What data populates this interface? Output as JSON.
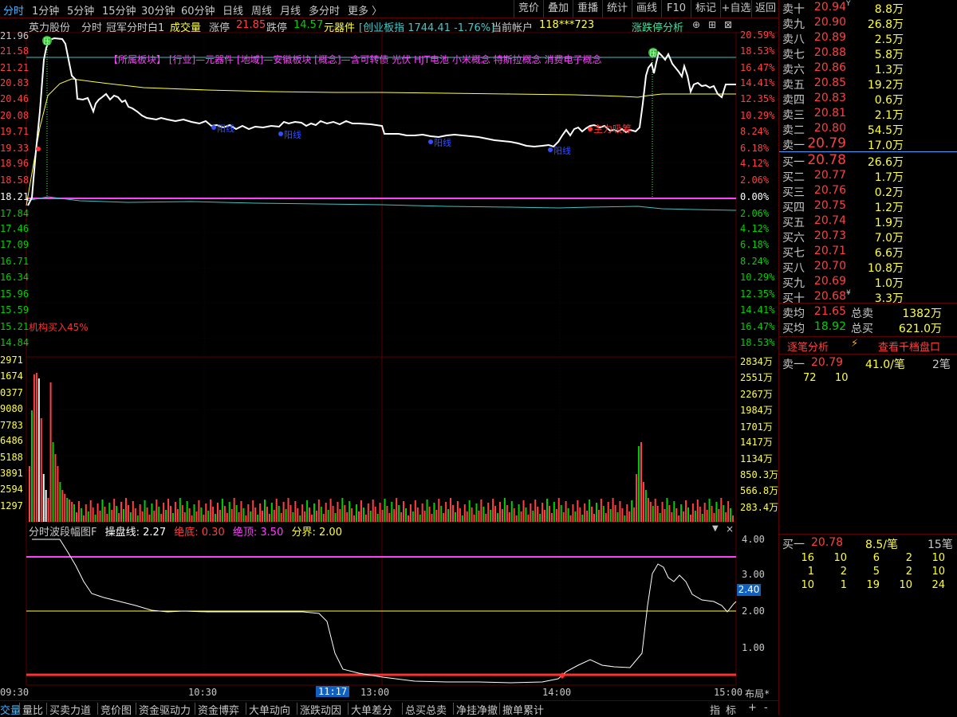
{
  "top_tabs": [
    "分时",
    "1分钟",
    "5分钟",
    "15分钟",
    "30分钟",
    "60分钟",
    "日线",
    "周线",
    "月线",
    "多分时",
    "更多 〉"
  ],
  "right_buttons": [
    "竞价",
    "叠加",
    "重播",
    "统计",
    "画线",
    "F10",
    "标记",
    "+自选",
    "返回"
  ],
  "info": {
    "stock_name": "英力股份",
    "mode": "分时",
    "indicator": "冠军分时白1",
    "volume_label": "成交量",
    "limit_up_label": "涨停",
    "limit_up_value": "21.85",
    "limit_down_label": "跌停",
    "limit_down_value": "14.57",
    "sector": "元器件",
    "index_text": "[创业板指 1744.41 -1.76%]",
    "account_label": "当前帐户",
    "account_value": "118***723",
    "analysis_button": "涨跌停分析"
  },
  "colors": {
    "up": "#ff4040",
    "down": "#00d000",
    "yellow": "#ffff40",
    "magenta": "#ff40ff",
    "cyan": "#40ffff",
    "white": "#ffffff",
    "grid": "#5a0000"
  },
  "price_axis_left": [
    "21.96",
    "21.58",
    "21.21",
    "20.83",
    "20.46",
    "20.08",
    "19.71",
    "19.33",
    "18.96",
    "18.58",
    "18.21",
    "17.84",
    "17.46",
    "17.09",
    "16.71",
    "16.34",
    "15.96",
    "15.59",
    "15.21",
    "14.84"
  ],
  "price_axis_right": [
    "20.59%",
    "18.53%",
    "16.47%",
    "14.41%",
    "12.35%",
    "10.29%",
    "8.24%",
    "6.18%",
    "4.12%",
    "2.06%",
    "0.00%",
    "2.06%",
    "4.12%",
    "6.18%",
    "8.24%",
    "10.29%",
    "12.35%",
    "14.41%",
    "16.47%",
    "18.53%"
  ],
  "volume_axis_left": [
    "2971",
    "1674",
    "0377",
    "9080",
    "7783",
    "6486",
    "5188",
    "3891",
    "2594",
    "1297"
  ],
  "volume_axis_right": [
    "2834万",
    "2551万",
    "2267万",
    "1984万",
    "1701万",
    "1417万",
    "1134万",
    "850.3万",
    "566.8万",
    "283.4万"
  ],
  "chart_text": {
    "concepts": "【所属板块】   [行业]—元器件    [地域]—安徽板块     [概念]—含可转债 光伏 HJT电池 小米概念 特斯拉概念 消费电子概念",
    "label_yang_1": "阳线",
    "label_yang_2": "阳线",
    "label_yang_3": "阳线",
    "label_yang_4": "阳线",
    "main_force": "主力吸筹",
    "institution": "机构买入45%",
    "marker": "压"
  },
  "indicator_panel": {
    "name": "分时波段幅图F",
    "op_label": "操盘线:",
    "op_value": "2.27",
    "bottom_label": "绝底:",
    "bottom_value": "0.30",
    "top_label": "绝顶:",
    "top_value": "3.50",
    "split_label": "分界:",
    "split_value": "2.00",
    "axis": [
      "4.00",
      "3.00",
      "2.00",
      "1.00"
    ],
    "current": "2.40"
  },
  "time_axis": [
    "09:30",
    "10:30",
    "11:17",
    "13:00",
    "14:00",
    "15:00"
  ],
  "layout_label": "布局*",
  "order_book": {
    "sell": [
      {
        "label": "卖十",
        "price": "20.94",
        "vol": "8.8万",
        "flag": "Y"
      },
      {
        "label": "卖九",
        "price": "20.90",
        "vol": "26.8万"
      },
      {
        "label": "卖八",
        "price": "20.89",
        "vol": "2.5万"
      },
      {
        "label": "卖七",
        "price": "20.88",
        "vol": "5.8万"
      },
      {
        "label": "卖六",
        "price": "20.86",
        "vol": "1.3万"
      },
      {
        "label": "卖五",
        "price": "20.85",
        "vol": "19.2万"
      },
      {
        "label": "卖四",
        "price": "20.83",
        "vol": "0.6万"
      },
      {
        "label": "卖三",
        "price": "20.81",
        "vol": "2.1万"
      },
      {
        "label": "卖二",
        "price": "20.80",
        "vol": "54.5万"
      },
      {
        "label": "卖一",
        "price": "20.79",
        "vol": "17.0万"
      }
    ],
    "buy": [
      {
        "label": "买一",
        "price": "20.78",
        "vol": "26.6万"
      },
      {
        "label": "买二",
        "price": "20.77",
        "vol": "1.7万"
      },
      {
        "label": "买三",
        "price": "20.76",
        "vol": "0.2万"
      },
      {
        "label": "买四",
        "price": "20.75",
        "vol": "1.2万"
      },
      {
        "label": "买五",
        "price": "20.74",
        "vol": "1.9万"
      },
      {
        "label": "买六",
        "price": "20.73",
        "vol": "7.0万"
      },
      {
        "label": "买七",
        "price": "20.71",
        "vol": "6.6万"
      },
      {
        "label": "买八",
        "price": "20.70",
        "vol": "10.8万"
      },
      {
        "label": "买九",
        "price": "20.69",
        "vol": "1.0万"
      },
      {
        "label": "买十",
        "price": "20.68",
        "vol": "3.3万",
        "flag": "¥"
      }
    ],
    "avg_sell_label": "卖均",
    "avg_sell": "21.65",
    "total_sell_label": "总卖",
    "total_sell": "1382万",
    "avg_buy_label": "买均",
    "avg_buy": "18.92",
    "total_buy_label": "总买",
    "total_buy": "621.0万",
    "tick_analysis": "逐笔分析",
    "view_1000": "查看千档盘口",
    "sell1_label": "卖一",
    "sell1_price": "20.79",
    "sell1_vol": "41.0/笔",
    "sell1_count": "2笔",
    "sell1_orders": [
      "72",
      "10"
    ],
    "buy1_label": "买一",
    "buy1_price": "20.78",
    "buy1_vol": "8.5/笔",
    "buy1_count": "15笔",
    "buy1_orders": [
      [
        "16",
        "10",
        "6",
        "2",
        "10"
      ],
      [
        "1",
        "2",
        "5",
        "2",
        "10"
      ],
      [
        "10",
        "1",
        "19",
        "10",
        "24"
      ]
    ]
  },
  "bottom_tabs": [
    "交量",
    "量比",
    "买卖力道",
    "竞价图",
    "资金驱动力",
    "资金博弈",
    "大单动向",
    "涨跌动因",
    "大单差分",
    "总买总卖",
    "净挂净撤",
    "撤单累计"
  ],
  "bottom_right": [
    "指",
    "标",
    "+",
    "-"
  ]
}
